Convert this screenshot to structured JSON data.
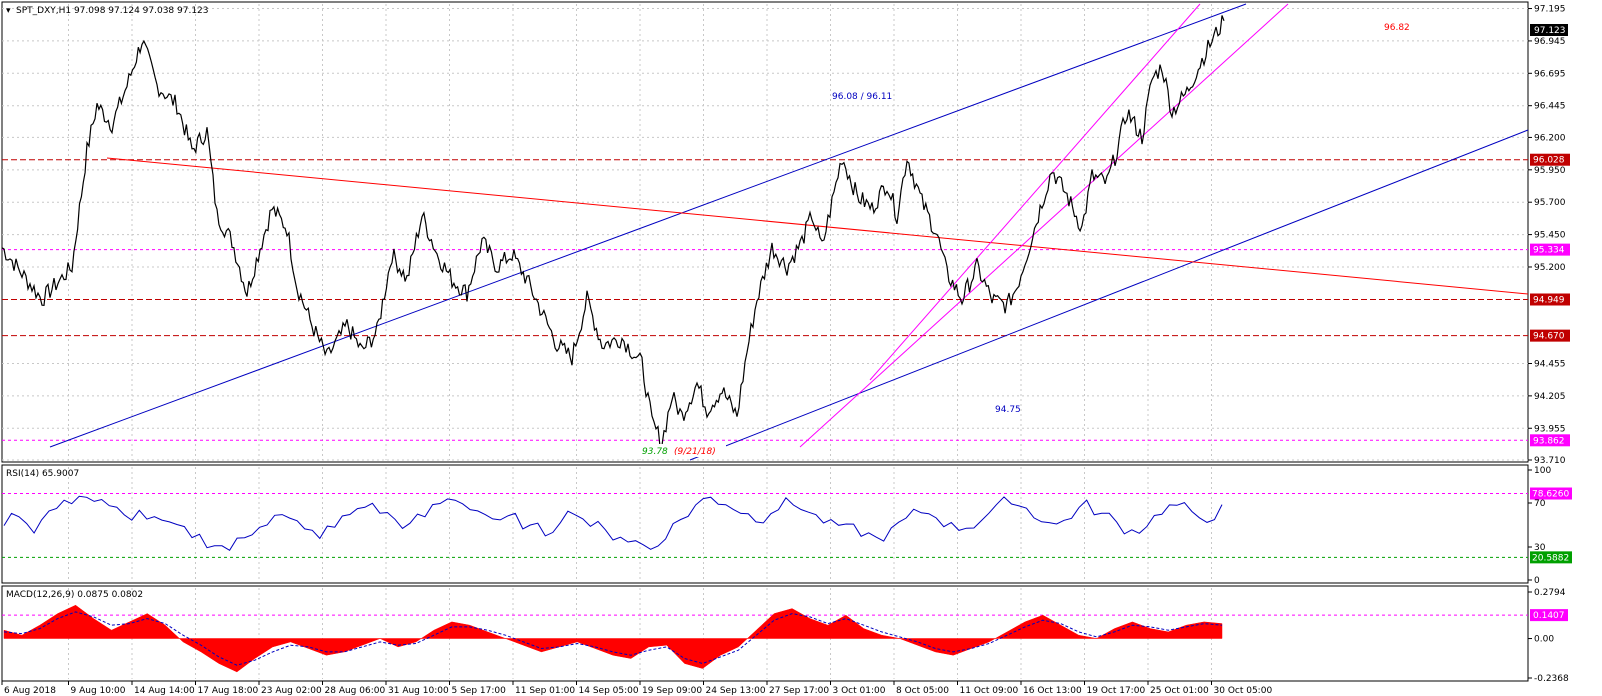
{
  "chart_data": {
    "type": "line",
    "symbol": "SPT_DXY",
    "timeframe": "H1",
    "header_text": "SPT_DXY,H1  97.098 97.124 97.038 97.123",
    "current_price": "97.123",
    "y_ticks": [
      "97.195",
      "96.945",
      "96.695",
      "96.445",
      "96.200",
      "95.950",
      "95.700",
      "95.450",
      "95.200",
      "94.455",
      "94.205",
      "93.955",
      "93.710"
    ],
    "ylim": [
      93.71,
      97.23
    ],
    "price_levels": [
      {
        "label": "96.028",
        "value": 96.028,
        "color": "#c00000",
        "style": "dashed"
      },
      {
        "label": "95.334",
        "value": 95.334,
        "color": "#ff00ff",
        "style": "dashed"
      },
      {
        "label": "94.949",
        "value": 94.949,
        "color": "#c00000",
        "style": "dashed"
      },
      {
        "label": "94.670",
        "value": 94.67,
        "color": "#c00000",
        "style": "dashed"
      },
      {
        "label": "93.862",
        "value": 93.862,
        "color": "#ff00ff",
        "style": "dashed"
      }
    ],
    "annotations": [
      {
        "text": "96.82",
        "color": "#ff0000"
      },
      {
        "text": "96.08 / 96.11",
        "color": "#0000c0"
      },
      {
        "text": "94.75",
        "color": "#0000c0"
      },
      {
        "text": "93.78",
        "color": "#00a000"
      },
      {
        "text": "(9/21/18)",
        "color": "#ff0000"
      }
    ],
    "x_ticks": [
      "6 Aug 2018",
      "9 Aug 10:00",
      "14 Aug 14:00",
      "17 Aug 18:00",
      "23 Aug 02:00",
      "28 Aug 06:00",
      "31 Aug 10:00",
      "5 Sep 17:00",
      "11 Sep 01:00",
      "14 Sep 05:00",
      "19 Sep 09:00",
      "24 Sep 13:00",
      "27 Sep 17:00",
      "3 Oct 01:00",
      "8 Oct 05:00",
      "11 Oct 09:00",
      "16 Oct 13:00",
      "19 Oct 17:00",
      "25 Oct 01:00",
      "30 Oct 05:00"
    ],
    "price_series": [
      [
        0,
        95.35
      ],
      [
        40,
        94.95
      ],
      [
        70,
        95.2
      ],
      [
        85,
        96.1
      ],
      [
        95,
        96.45
      ],
      [
        110,
        96.3
      ],
      [
        125,
        96.6
      ],
      [
        140,
        96.95
      ],
      [
        155,
        96.6
      ],
      [
        175,
        96.45
      ],
      [
        190,
        96.1
      ],
      [
        205,
        96.25
      ],
      [
        215,
        95.6
      ],
      [
        230,
        95.4
      ],
      [
        245,
        95.0
      ],
      [
        260,
        95.4
      ],
      [
        270,
        95.65
      ],
      [
        285,
        95.5
      ],
      [
        295,
        95.05
      ],
      [
        310,
        94.75
      ],
      [
        325,
        94.5
      ],
      [
        345,
        94.75
      ],
      [
        360,
        94.55
      ],
      [
        375,
        94.7
      ],
      [
        390,
        95.3
      ],
      [
        405,
        95.1
      ],
      [
        420,
        95.6
      ],
      [
        435,
        95.3
      ],
      [
        450,
        95.1
      ],
      [
        465,
        95.0
      ],
      [
        480,
        95.4
      ],
      [
        495,
        95.2
      ],
      [
        510,
        95.3
      ],
      [
        525,
        95.1
      ],
      [
        540,
        94.85
      ],
      [
        555,
        94.6
      ],
      [
        570,
        94.5
      ],
      [
        585,
        94.95
      ],
      [
        600,
        94.6
      ],
      [
        620,
        94.65
      ],
      [
        640,
        94.45
      ],
      [
        650,
        94.0
      ],
      [
        660,
        93.85
      ],
      [
        670,
        94.2
      ],
      [
        680,
        94.05
      ],
      [
        695,
        94.3
      ],
      [
        705,
        94.1
      ],
      [
        720,
        94.25
      ],
      [
        735,
        94.05
      ],
      [
        745,
        94.55
      ],
      [
        755,
        94.95
      ],
      [
        770,
        95.35
      ],
      [
        785,
        95.2
      ],
      [
        800,
        95.4
      ],
      [
        810,
        95.6
      ],
      [
        820,
        95.35
      ],
      [
        830,
        95.7
      ],
      [
        840,
        96.05
      ],
      [
        855,
        95.75
      ],
      [
        870,
        95.65
      ],
      [
        885,
        95.85
      ],
      [
        895,
        95.6
      ],
      [
        905,
        96.05
      ],
      [
        920,
        95.7
      ],
      [
        935,
        95.45
      ],
      [
        945,
        95.15
      ],
      [
        960,
        94.95
      ],
      [
        975,
        95.2
      ],
      [
        990,
        94.95
      ],
      [
        1005,
        94.9
      ],
      [
        1015,
        95.05
      ],
      [
        1025,
        95.3
      ],
      [
        1040,
        95.7
      ],
      [
        1050,
        95.95
      ],
      [
        1065,
        95.75
      ],
      [
        1080,
        95.5
      ],
      [
        1090,
        95.9
      ],
      [
        1105,
        95.85
      ],
      [
        1115,
        96.1
      ],
      [
        1125,
        96.4
      ],
      [
        1140,
        96.2
      ],
      [
        1150,
        96.65
      ],
      [
        1160,
        96.75
      ],
      [
        1170,
        96.4
      ],
      [
        1185,
        96.55
      ],
      [
        1200,
        96.8
      ],
      [
        1210,
        96.95
      ],
      [
        1222,
        97.1
      ]
    ],
    "rsi": {
      "label": "RSI(14) 65.9007",
      "ylim": [
        0,
        100
      ],
      "ticks": [
        "100",
        "70",
        "30",
        "0"
      ],
      "levels": [
        {
          "label": "78.6260",
          "value": 78.626,
          "color": "#ff00ff"
        },
        {
          "label": "20.5882",
          "value": 20.5882,
          "color": "#00a000"
        }
      ],
      "series": [
        52,
        60,
        45,
        62,
        70,
        78,
        72,
        66,
        58,
        62,
        55,
        50,
        46,
        40,
        32,
        28,
        38,
        50,
        60,
        55,
        45,
        40,
        48,
        60,
        68,
        62,
        55,
        50,
        58,
        70,
        74,
        66,
        60,
        52,
        58,
        48,
        42,
        55,
        62,
        50,
        44,
        40,
        35,
        28,
        40,
        55,
        68,
        75,
        70,
        62,
        55,
        62,
        72,
        66,
        58,
        52,
        48,
        42,
        38,
        45,
        55,
        62,
        58,
        50,
        48,
        55,
        66,
        72,
        65,
        55,
        50,
        58,
        70,
        60,
        52,
        45,
        50,
        62,
        68,
        60,
        55,
        66
      ]
    },
    "macd": {
      "label": "MACD(12,26,9) 0.0875 0.0802",
      "ylim": [
        -0.2368,
        0.2794
      ],
      "ticks": [
        "0.2794",
        "0.00",
        "-0.2368"
      ],
      "level": {
        "label": "0.1407",
        "value": 0.1407,
        "color": "#ff00ff"
      },
      "histogram": [
        0.05,
        0.02,
        0.08,
        0.15,
        0.2,
        0.12,
        0.05,
        0.1,
        0.15,
        0.08,
        -0.02,
        -0.08,
        -0.15,
        -0.2,
        -0.12,
        -0.05,
        -0.02,
        -0.06,
        -0.1,
        -0.08,
        -0.04,
        0.0,
        -0.05,
        -0.02,
        0.05,
        0.1,
        0.08,
        0.04,
        0.0,
        -0.04,
        -0.08,
        -0.05,
        -0.02,
        -0.06,
        -0.1,
        -0.12,
        -0.05,
        -0.04,
        -0.15,
        -0.18,
        -0.1,
        -0.05,
        0.05,
        0.15,
        0.18,
        0.12,
        0.08,
        0.14,
        0.06,
        0.02,
        0.0,
        -0.04,
        -0.08,
        -0.1,
        -0.06,
        -0.02,
        0.04,
        0.1,
        0.14,
        0.08,
        0.02,
        0.0,
        0.06,
        0.1,
        0.06,
        0.04,
        0.08,
        0.1,
        0.09
      ],
      "signal": [
        0.04,
        0.03,
        0.06,
        0.12,
        0.16,
        0.13,
        0.08,
        0.09,
        0.12,
        0.09,
        0.02,
        -0.04,
        -0.11,
        -0.16,
        -0.13,
        -0.08,
        -0.04,
        -0.05,
        -0.08,
        -0.08,
        -0.05,
        -0.02,
        -0.04,
        -0.03,
        0.02,
        0.07,
        0.07,
        0.05,
        0.02,
        -0.02,
        -0.06,
        -0.05,
        -0.03,
        -0.05,
        -0.08,
        -0.1,
        -0.07,
        -0.05,
        -0.12,
        -0.15,
        -0.11,
        -0.07,
        0.02,
        0.11,
        0.15,
        0.13,
        0.09,
        0.12,
        0.08,
        0.04,
        0.01,
        -0.02,
        -0.06,
        -0.08,
        -0.06,
        -0.03,
        0.02,
        0.07,
        0.11,
        0.09,
        0.04,
        0.01,
        0.04,
        0.08,
        0.07,
        0.05,
        0.07,
        0.09,
        0.08
      ]
    }
  }
}
